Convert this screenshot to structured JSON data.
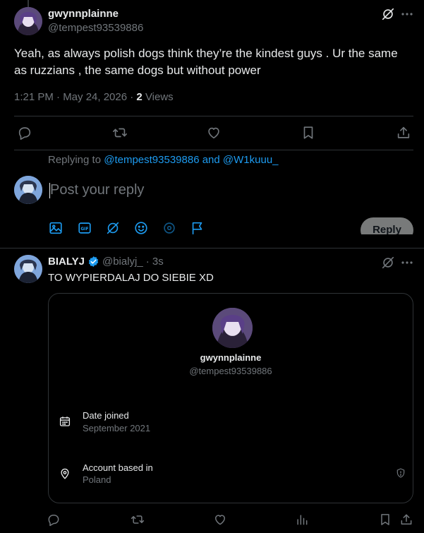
{
  "tweet": {
    "author_name": "gwynnplainne",
    "author_handle": "@tempest93539886",
    "text": "Yeah, as always polish dogs think they’re the kindest guys . Ur the same as ruzzians , the same dogs but without power",
    "timestamp": "1:21 PM · May 24, 2026 ·",
    "views_count": "2",
    "views_label": "Views"
  },
  "actions": {
    "reply_icon": "reply-icon",
    "retweet_icon": "retweet-icon",
    "like_icon": "heart-icon",
    "bookmark_icon": "bookmark-icon",
    "share_icon": "share-icon"
  },
  "composer": {
    "replying_prefix": "Replying to",
    "replying_user1": "@tempest93539886",
    "replying_and": "and",
    "replying_user2": "@W1kuuu_",
    "placeholder": "Post your reply",
    "reply_button": "Reply"
  },
  "reply_tweet": {
    "author_name": "BIALYJ",
    "author_handle": "@bialyj_",
    "time": "· 3s",
    "text": "TO WYPIERDALAJ DO SIEBIE XD"
  },
  "profile_card": {
    "name": "gwynnplainne",
    "handle": "@tempest93539886",
    "date_joined_label": "Date joined",
    "date_joined_value": "September 2021",
    "location_label": "Account based in",
    "location_value": "Poland"
  },
  "colors": {
    "background": "#000000",
    "text": "#e7e9ea",
    "muted": "#71767b",
    "accent": "#1d9bf0",
    "divider": "#2f3336"
  }
}
